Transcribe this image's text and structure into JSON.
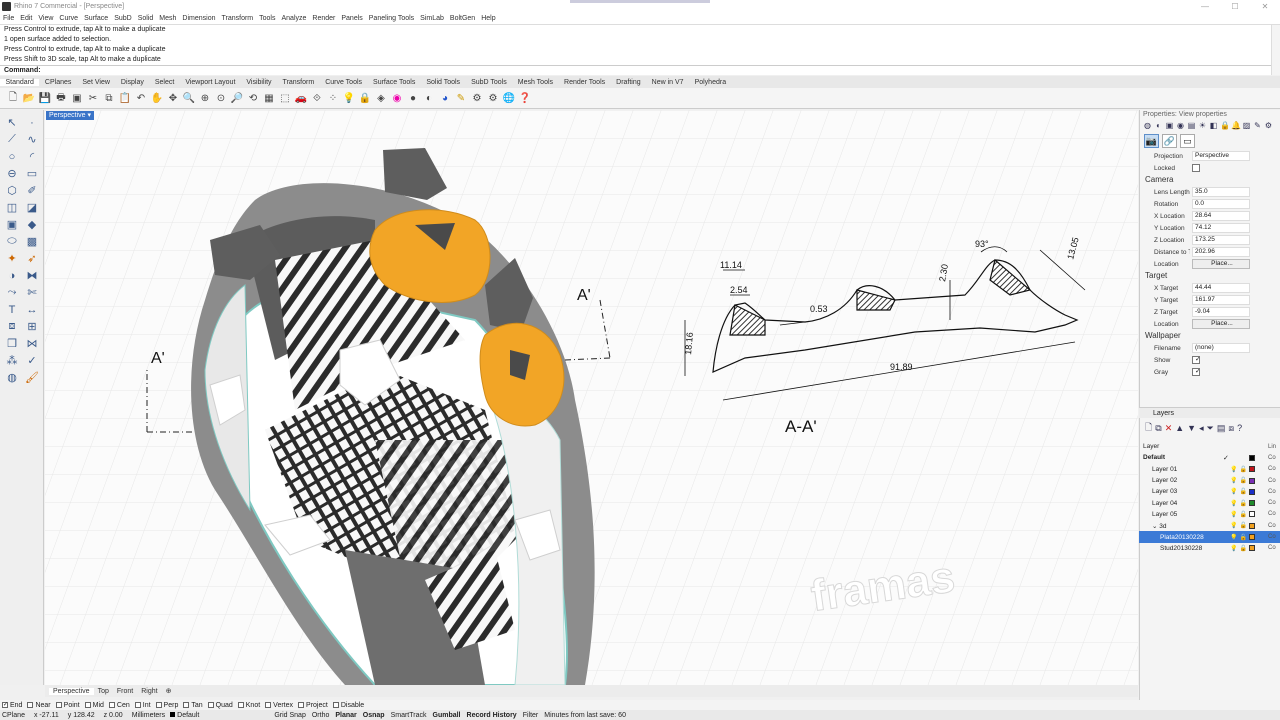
{
  "window": {
    "title": "Rhino 7 Commercial - [Perspective]",
    "controls": [
      "—",
      "☐",
      "✕"
    ]
  },
  "menu": [
    "File",
    "Edit",
    "View",
    "Curve",
    "Surface",
    "SubD",
    "Solid",
    "Mesh",
    "Dimension",
    "Transform",
    "Tools",
    "Analyze",
    "Render",
    "Panels",
    "Paneling Tools",
    "SimLab",
    "BoltGen",
    "Help"
  ],
  "command_history": [
    "Press Control to extrude, tap Alt to make a duplicate",
    "1 open surface added to selection.",
    "Press Control to extrude, tap Alt to make a duplicate",
    "Press Shift to 3D scale, tap Alt to make a duplicate"
  ],
  "command_prompt": "Command:",
  "toolbar_tabs": [
    "Standard",
    "CPlanes",
    "Set View",
    "Display",
    "Select",
    "Viewport Layout",
    "Visibility",
    "Transform",
    "Curve Tools",
    "Surface Tools",
    "Solid Tools",
    "SubD Tools",
    "Mesh Tools",
    "Render Tools",
    "Drafting",
    "New in V7",
    "Polyhedra"
  ],
  "viewport": {
    "label": "Perspective ▾",
    "section_label_left": "A'",
    "section_label_right": "A'",
    "section_title": "A-A'",
    "brand": "framas",
    "dimensions": {
      "angle": "93°",
      "width_top": "11.14",
      "small": "2.54",
      "thin": "0.53",
      "height_mid": "2.30",
      "height_right": "13.05",
      "height_left": "18.16",
      "total": "91.89"
    }
  },
  "viewport_tabs": [
    "Perspective",
    "Top",
    "Front",
    "Right",
    "⊕"
  ],
  "osnaps": [
    {
      "label": "End",
      "on": true
    },
    {
      "label": "Near",
      "on": false
    },
    {
      "label": "Point",
      "on": false
    },
    {
      "label": "Mid",
      "on": false
    },
    {
      "label": "Cen",
      "on": false
    },
    {
      "label": "Int",
      "on": false
    },
    {
      "label": "Perp",
      "on": false
    },
    {
      "label": "Tan",
      "on": false
    },
    {
      "label": "Quad",
      "on": false
    },
    {
      "label": "Knot",
      "on": false
    },
    {
      "label": "Vertex",
      "on": false
    },
    {
      "label": "Project",
      "on": false
    },
    {
      "label": "Disable",
      "on": false
    }
  ],
  "status": {
    "cplane": "CPlane",
    "x": "x -27.11",
    "y": "y 128.42",
    "z": "z 0.00",
    "units": "Millimeters",
    "layer": "Default",
    "toggles": [
      {
        "label": "Grid Snap",
        "on": false
      },
      {
        "label": "Ortho",
        "on": false
      },
      {
        "label": "Planar",
        "on": true
      },
      {
        "label": "Osnap",
        "on": true
      },
      {
        "label": "SmartTrack",
        "on": false
      },
      {
        "label": "Gumball",
        "on": true
      },
      {
        "label": "Record History",
        "on": true
      },
      {
        "label": "Filter",
        "on": false
      }
    ],
    "message": "Minutes from last save: 60"
  },
  "properties": {
    "header": "Properties: View properties",
    "rows": [
      {
        "k": "Projection",
        "v": "Perspective",
        "t": "select"
      },
      {
        "k": "Locked",
        "v": "",
        "t": "cb"
      }
    ],
    "camera_title": "Camera",
    "camera": [
      {
        "k": "Lens Length(...",
        "v": "35.0"
      },
      {
        "k": "Rotation",
        "v": "0.0"
      },
      {
        "k": "X Location",
        "v": "28.64"
      },
      {
        "k": "Y Location",
        "v": "74.12"
      },
      {
        "k": "Z Location",
        "v": "173.25"
      },
      {
        "k": "Distance to Ta...",
        "v": "202.96"
      },
      {
        "k": "Location",
        "v": "Place...",
        "t": "btn"
      }
    ],
    "target_title": "Target",
    "target": [
      {
        "k": "X Target",
        "v": "44.44"
      },
      {
        "k": "Y Target",
        "v": "161.97"
      },
      {
        "k": "Z Target",
        "v": "-9.04"
      },
      {
        "k": "Location",
        "v": "Place...",
        "t": "btn"
      }
    ],
    "wallpaper_title": "Wallpaper",
    "wallpaper": [
      {
        "k": "Filename",
        "v": "(none)"
      },
      {
        "k": "Show",
        "v": "✓",
        "t": "cb"
      },
      {
        "k": "Gray",
        "v": "✓",
        "t": "cb"
      }
    ]
  },
  "layers": {
    "title": "Layers",
    "header": "Layer",
    "header_right": "Lin",
    "rows": [
      {
        "name": "Default",
        "color": "#000000",
        "mat": "Co",
        "level": "top",
        "bold": true,
        "current": "✓"
      },
      {
        "name": "Layer 01",
        "color": "#c0141a",
        "mat": "Co",
        "level": "child"
      },
      {
        "name": "Layer 02",
        "color": "#7a2fb4",
        "mat": "Co",
        "level": "child"
      },
      {
        "name": "Layer 03",
        "color": "#1a2fc8",
        "mat": "Co",
        "level": "child"
      },
      {
        "name": "Layer 04",
        "color": "#1f8a2b",
        "mat": "Co",
        "level": "child"
      },
      {
        "name": "Layer 05",
        "color": "#ffffff",
        "mat": "Co",
        "level": "child"
      },
      {
        "name": "⌄ 3d",
        "color": "#f0a020",
        "mat": "Co",
        "level": "child"
      },
      {
        "name": "Plata20130228",
        "color": "#f0a020",
        "mat": "Co",
        "level": "sub",
        "selected": true
      },
      {
        "name": "Stud20130228",
        "color": "#f0a020",
        "mat": "Co",
        "level": "sub"
      }
    ]
  }
}
